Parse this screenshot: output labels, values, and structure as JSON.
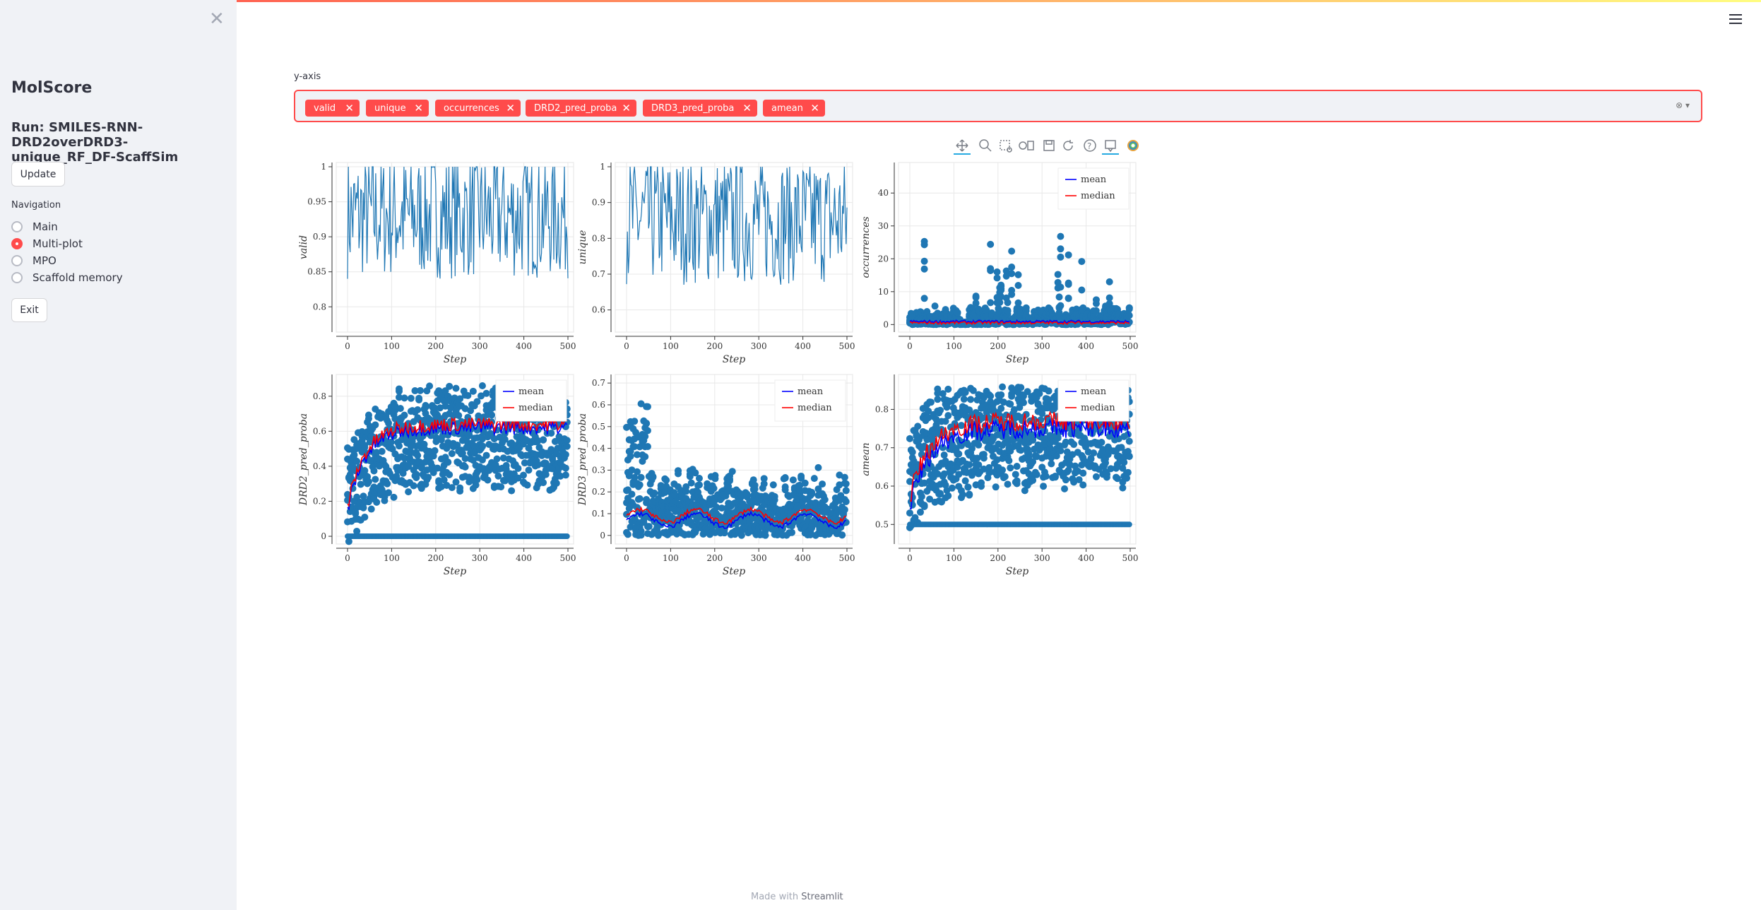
{
  "sidebar": {
    "close_icon": "close-icon",
    "app_title": "MolScore",
    "run_title": "Run: SMILES-RNN-DRD2overDRD3-unique_RF_DF-ScaffSim",
    "update_label": "Update",
    "nav_label": "Navigation",
    "nav_options": [
      "Main",
      "Multi-plot",
      "MPO",
      "Scaffold memory"
    ],
    "nav_selected": "Multi-plot",
    "exit_label": "Exit"
  },
  "main": {
    "yaxis_label": "y-axis",
    "selected_metrics": [
      "valid",
      "unique",
      "occurrences",
      "DRD2_pred_proba",
      "DRD3_pred_proba",
      "amean"
    ],
    "accent_color": "#ff4b4b",
    "footer_prefix": "Made with",
    "footer_brand": "Streamlit"
  },
  "toolbar": {
    "icons": [
      "pan-icon",
      "wheel-zoom-icon",
      "box-zoom-icon",
      "box-select-icon",
      "save-icon",
      "reset-icon",
      "help-icon",
      "hover-icon",
      "bokeh-logo-icon"
    ]
  },
  "chart_data": [
    {
      "type": "line",
      "title": "",
      "xlabel": "Step",
      "ylabel": "valid",
      "xlim": [
        0,
        500
      ],
      "ylim": [
        0.77,
        1.0
      ],
      "xticks": [
        "0",
        "100",
        "200",
        "300",
        "400",
        "500"
      ],
      "yticks": [
        "0.8",
        "0.85",
        "0.9",
        "0.95",
        "1"
      ],
      "series": [
        {
          "values_approx": "fluctuates between 0.78 and 1.0 over steps 0-500, mostly 0.85-1.0"
        }
      ]
    },
    {
      "type": "line",
      "title": "",
      "xlabel": "Step",
      "ylabel": "unique",
      "xlim": [
        0,
        500
      ],
      "ylim": [
        0.55,
        1.0
      ],
      "xticks": [
        "0",
        "100",
        "200",
        "300",
        "400",
        "500"
      ],
      "yticks": [
        "0.6",
        "0.7",
        "0.8",
        "0.9",
        "1"
      ],
      "series": [
        {
          "values_approx": "fluctuates between 0.57 and 1.0, mostly 0.75-0.95"
        }
      ]
    },
    {
      "type": "scatter",
      "title": "",
      "xlabel": "Step",
      "ylabel": "occurrences",
      "xlim": [
        0,
        500
      ],
      "ylim": [
        -1,
        48
      ],
      "xticks": [
        "0",
        "100",
        "200",
        "300",
        "400",
        "500"
      ],
      "yticks": [
        "0",
        "10",
        "20",
        "30",
        "40"
      ],
      "legend": [
        "mean",
        "median"
      ],
      "legend_position": "top-right",
      "series": [
        {
          "name": "mean",
          "color": "#0000ff"
        },
        {
          "name": "median",
          "color": "#ff0000"
        }
      ]
    },
    {
      "type": "scatter",
      "title": "",
      "xlabel": "Step",
      "ylabel": "DRD2_pred_proba",
      "xlim": [
        0,
        500
      ],
      "ylim": [
        -0.02,
        0.9
      ],
      "xticks": [
        "0",
        "100",
        "200",
        "300",
        "400",
        "500"
      ],
      "yticks": [
        "0",
        "0.2",
        "0.4",
        "0.6",
        "0.8"
      ],
      "legend": [
        "mean",
        "median"
      ],
      "legend_position": "top-right",
      "series": [
        {
          "name": "mean",
          "color": "#0000ff"
        },
        {
          "name": "median",
          "color": "#ff0000"
        }
      ]
    },
    {
      "type": "scatter",
      "title": "",
      "xlabel": "Step",
      "ylabel": "DRD3_pred_proba",
      "xlim": [
        0,
        500
      ],
      "ylim": [
        -0.02,
        0.72
      ],
      "xticks": [
        "0",
        "100",
        "200",
        "300",
        "400",
        "500"
      ],
      "yticks": [
        "0",
        "0.1",
        "0.2",
        "0.3",
        "0.4",
        "0.5",
        "0.6",
        "0.7"
      ],
      "legend": [
        "mean",
        "median"
      ],
      "legend_position": "top-right",
      "series": [
        {
          "name": "mean",
          "color": "#0000ff"
        },
        {
          "name": "median",
          "color": "#ff0000"
        }
      ]
    },
    {
      "type": "scatter",
      "title": "",
      "xlabel": "Step",
      "ylabel": "amean",
      "xlim": [
        0,
        500
      ],
      "ylim": [
        0.46,
        0.88
      ],
      "xticks": [
        "0",
        "100",
        "200",
        "300",
        "400",
        "500"
      ],
      "yticks": [
        "0.5",
        "0.6",
        "0.7",
        "0.8"
      ],
      "legend": [
        "mean",
        "median"
      ],
      "legend_position": "top-right",
      "series": [
        {
          "name": "mean",
          "color": "#0000ff"
        },
        {
          "name": "median",
          "color": "#ff0000"
        }
      ]
    }
  ]
}
